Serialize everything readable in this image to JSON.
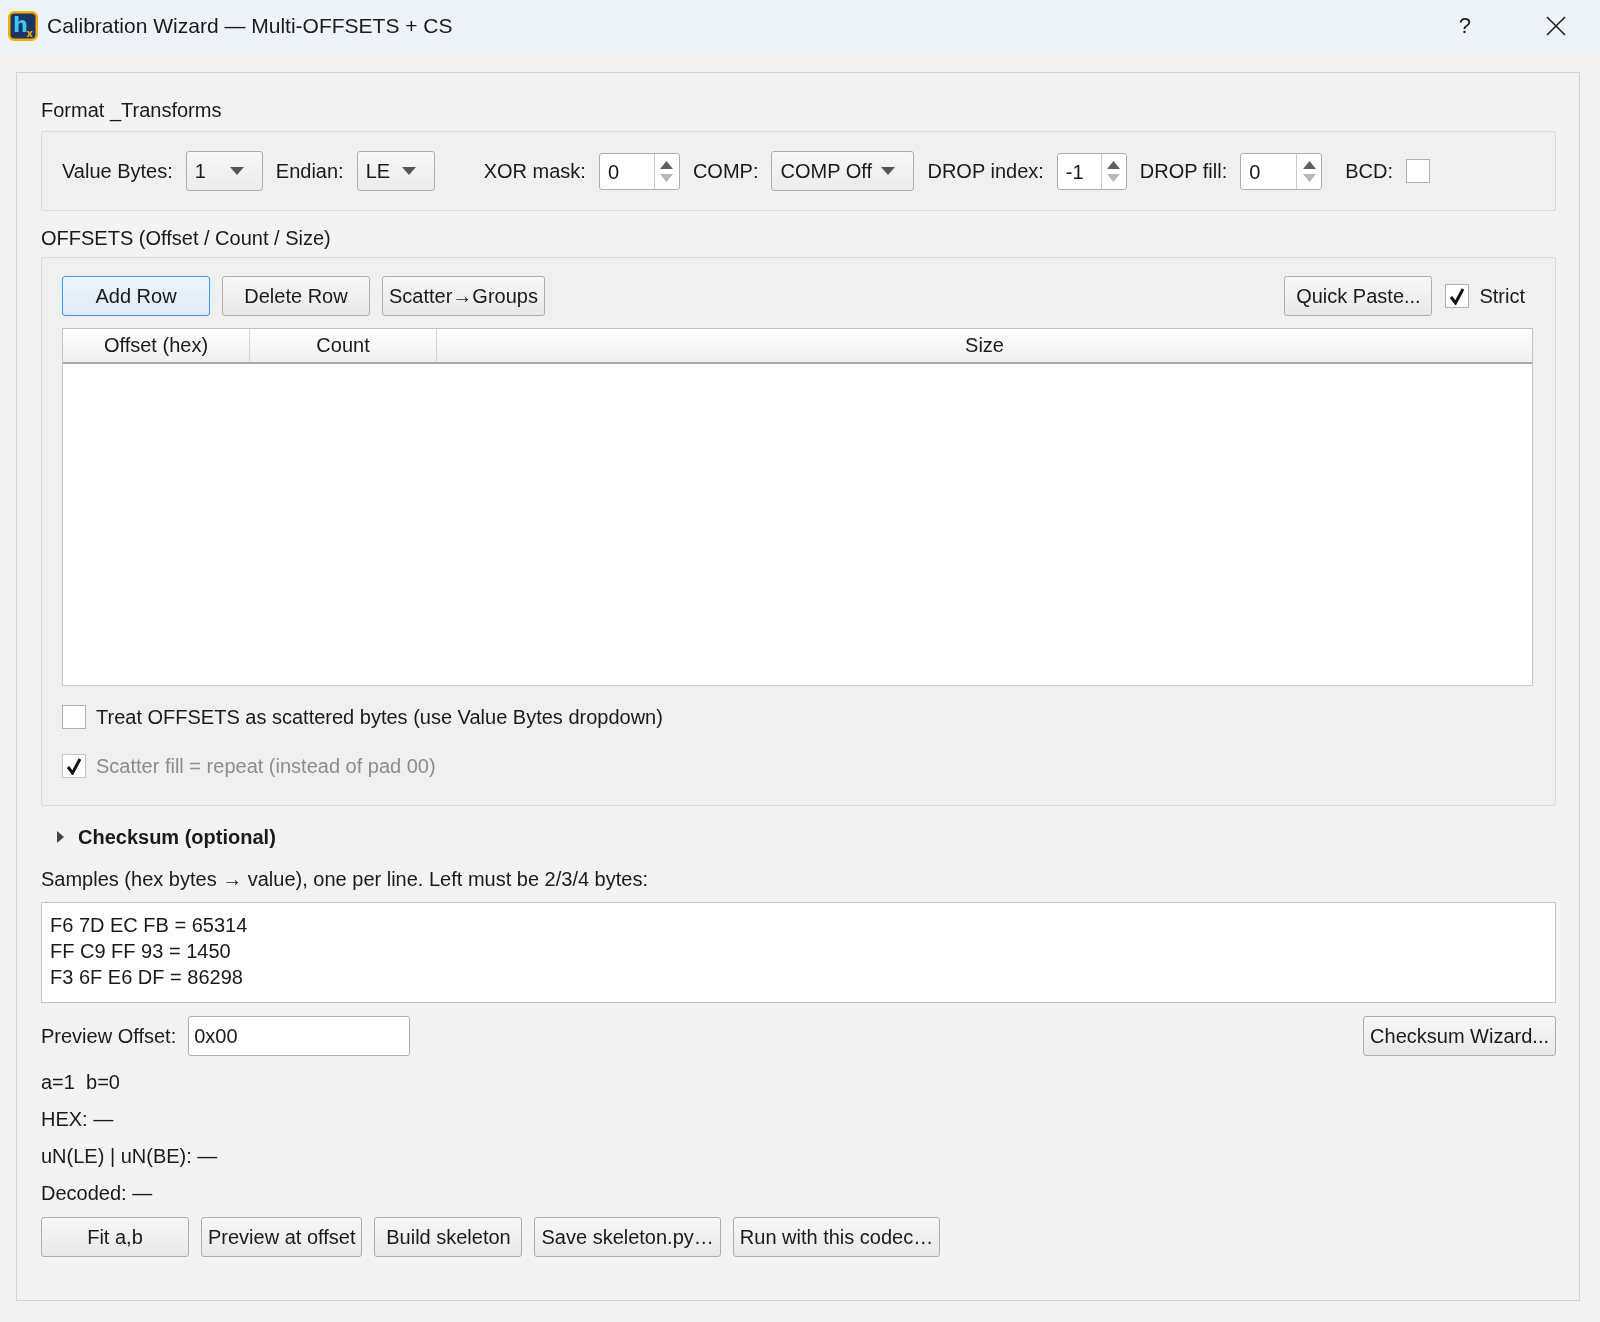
{
  "window": {
    "logo": {
      "main": "h",
      "sub": "x"
    },
    "title": "Calibration Wizard — Multi-OFFSETS + CS",
    "help": "?"
  },
  "format_transforms": {
    "title": "Format _Transforms",
    "controls": [
      {
        "kind": "combo",
        "label": "Value Bytes:",
        "value": "1"
      },
      {
        "kind": "combo",
        "label": "Endian:",
        "value": "LE"
      },
      {
        "kind": "spin",
        "label": "XOR mask:",
        "value": "0"
      },
      {
        "kind": "combo",
        "label": "COMP:",
        "value": "COMP Off"
      },
      {
        "kind": "spin",
        "label": "DROP index:",
        "value": "-1"
      },
      {
        "kind": "spin",
        "label": "DROP fill:",
        "value": "0"
      },
      {
        "kind": "checkbox",
        "label": "BCD:",
        "checked": false
      }
    ]
  },
  "offsets": {
    "title": "OFFSETS (Offset / Count / Size)",
    "toolbar": [
      {
        "label": "Add Row",
        "focused": true
      },
      {
        "label": "Delete Row",
        "focused": false
      },
      {
        "label": "Scatter→Groups",
        "focused": false
      }
    ],
    "quick_paste": "Quick Paste...",
    "strict": {
      "label": "Strict",
      "checked": true
    },
    "table": {
      "columns": [
        "Offset (hex)",
        "Count",
        "Size"
      ]
    },
    "options": [
      {
        "label": "Treat OFFSETS as scattered bytes (use Value Bytes dropdown)",
        "checked": false,
        "disabled": false
      },
      {
        "label": "Scatter fill = repeat (instead of pad 00)",
        "checked": true,
        "disabled": true
      }
    ]
  },
  "checksum": {
    "title": "Checksum (optional)",
    "expanded": false
  },
  "samples": {
    "label": "Samples (hex bytes → value), one per line. Left must be 2/3/4 bytes:",
    "lines": [
      "F6 7D EC FB = 65314",
      "FF C9 FF 93 = 1450",
      "F3 6F E6 DF = 86298"
    ]
  },
  "preview": {
    "label": "Preview Offset:",
    "value": "0x00",
    "wizard_button": "Checksum Wizard..."
  },
  "results": [
    "a=1  b=0",
    "HEX: —",
    "uN(LE) | uN(BE): —",
    "Decoded: —"
  ],
  "actions": [
    "Fit a,b",
    "Preview at offset",
    "Build skeleton",
    "Save skeleton.py…",
    "Run with this codec…"
  ]
}
